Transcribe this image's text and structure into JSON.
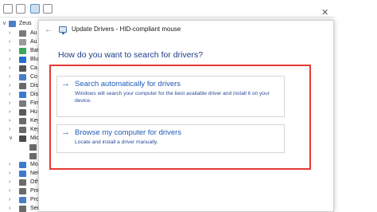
{
  "tree": {
    "computer_name": "Zeus",
    "items": [
      {
        "label": "Au",
        "color": "#7a7a7a"
      },
      {
        "label": "Au",
        "color": "#9a9a9a"
      },
      {
        "label": "Bat",
        "color": "#3aa65a"
      },
      {
        "label": "Blu",
        "color": "#1f6fd1"
      },
      {
        "label": "Ca",
        "color": "#555555"
      },
      {
        "label": "Co",
        "color": "#4a7fc4"
      },
      {
        "label": "Dis",
        "color": "#6a6a6a"
      },
      {
        "label": "Dis",
        "color": "#3b7ad1"
      },
      {
        "label": "Firr",
        "color": "#7a7a7a"
      },
      {
        "label": "Hu",
        "color": "#5a5a5a"
      },
      {
        "label": "Key",
        "color": "#6a6a6a"
      },
      {
        "label": "Key",
        "color": "#6a6a6a"
      },
      {
        "label": "Mic",
        "color": "#4a4a4a"
      },
      {
        "label": "",
        "color": "#6a6a6a"
      },
      {
        "label": "",
        "color": "#6a6a6a"
      },
      {
        "label": "Mo",
        "color": "#3b7ad1"
      },
      {
        "label": "Net",
        "color": "#3b7ad1"
      },
      {
        "label": "Oth",
        "color": "#6a6a6a"
      },
      {
        "label": "Prir",
        "color": "#6a6a6a"
      },
      {
        "label": "Pro",
        "color": "#4a7fc4"
      },
      {
        "label": "Ser",
        "color": "#6a6a6a"
      }
    ]
  },
  "dialog": {
    "title": "Update Drivers - HID-compliant mouse",
    "back_glyph": "←",
    "close_glyph": "✕",
    "question": "How do you want to search for drivers?",
    "options": [
      {
        "arrow": "→",
        "title": "Search automatically for drivers",
        "description": "Windows will search your computer for the best available driver and install it on your device."
      },
      {
        "arrow": "→",
        "title": "Browse my computer for drivers",
        "description": "Locate and install a driver manually."
      }
    ]
  },
  "colors": {
    "highlight": "#e53935",
    "link": "#1f5bb5",
    "heading": "#1e3a8a"
  }
}
